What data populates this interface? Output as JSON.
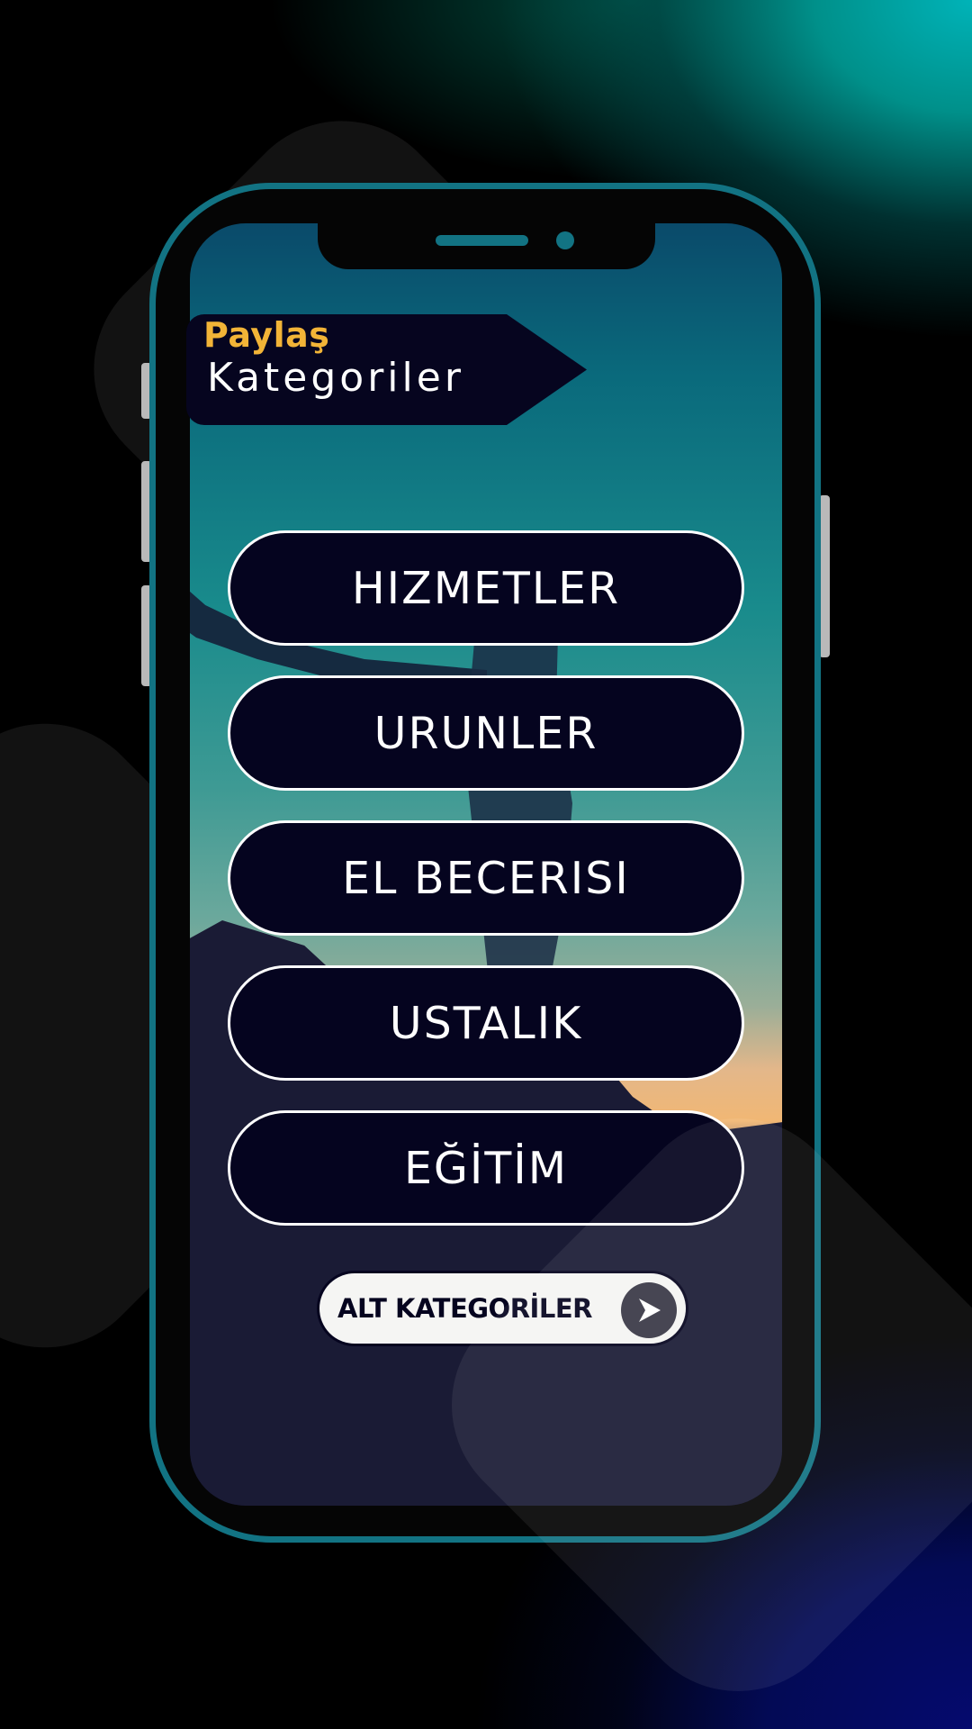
{
  "header": {
    "brand": "Paylaş",
    "title": "Kategoriler"
  },
  "categories": [
    {
      "label": "HIZMETLER"
    },
    {
      "label": "URUNLER"
    },
    {
      "label": "EL BECERISI"
    },
    {
      "label": "USTALIK"
    },
    {
      "label": "EĞİTİM"
    }
  ],
  "alt_button": {
    "label": "ALT KATEGORİLER",
    "icon": "chevron-right-icon"
  },
  "colors": {
    "brand": "#f2b437",
    "phone_frame": "#127383",
    "button_bg": "#05041f",
    "button_border": "#ffffff"
  }
}
